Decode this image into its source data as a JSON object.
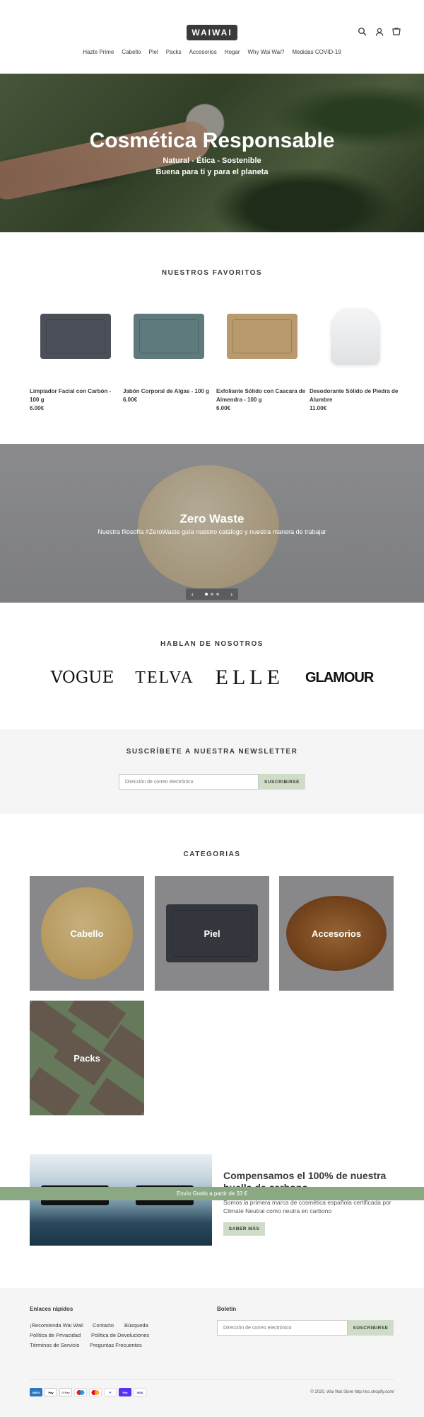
{
  "header": {
    "logo_text": "WAIWAI",
    "nav": [
      "Hazte Prime",
      "Cabello",
      "Piel",
      "Packs",
      "Accesorios",
      "Hogar",
      "Why Wai Wai?",
      "Medidas COVID-19"
    ],
    "icons": [
      "search-icon",
      "account-icon",
      "cart-icon"
    ]
  },
  "hero": {
    "title": "Cosmética Responsable",
    "subtitle1": "Natural - Ética - Sostenible",
    "subtitle2": "Buena para ti y para el planeta"
  },
  "favorites": {
    "title": "NUESTROS FAVORITOS",
    "products": [
      {
        "name": "Limpiador Facial con Carbón - 100 g",
        "price": "6.00€",
        "color": "#4b5058"
      },
      {
        "name": "Jabón Corporal de Algas - 100 g",
        "price": "6.00€",
        "color": "#5f7a7c"
      },
      {
        "name": "Exfoliante Sólido con Cascara de Almendra - 100 g",
        "price": "6.00€",
        "color": "#b89a6e"
      },
      {
        "name": "Desodorante Sólido de Piedra de Alumbre",
        "price": "11.00€",
        "color": "#e9eaec"
      }
    ]
  },
  "slideshow": {
    "title": "Zero Waste",
    "text": "Nuestra filosofía #ZeroWaste guía nuestro catálogo y nuestra manera de trabajar",
    "prev": "‹",
    "next": "›",
    "active_slide": 1,
    "slide_count": 3
  },
  "press": {
    "title": "HABLAN DE NOSOTROS",
    "logos": [
      "VOGUE",
      "TELVA",
      "ELLE",
      "GLAMOUR"
    ]
  },
  "newsletter": {
    "title": "SUSCRÍBETE A NUESTRA NEWSLETTER",
    "placeholder": "Dirección de correo electrónico",
    "button": "SUSCRIBIRSE"
  },
  "categories": {
    "title": "CATEGORIAS",
    "items": [
      "Cabello",
      "Piel",
      "Accesorios",
      "Packs"
    ]
  },
  "carbon": {
    "title": "Compensamos el 100% de nuestra huella de carbono",
    "text": "Somos la primera marca de cosmética española certificada por Climate Neutral como neutra en carbono",
    "button": "SABER MÁS",
    "image_logo": "WAIWAI"
  },
  "banner": {
    "text": "Envío Gratis a partir de 33 €"
  },
  "footer": {
    "links_title": "Enlaces rápidos",
    "links": [
      "¡Recomienda Wai Wai!",
      "Contacto",
      "Búsqueda",
      "Política de Privacidad",
      "Política de Devoluciones",
      "Términos de Servicio",
      "Preguntas Frecuentes"
    ],
    "newsletter_title": "Boletín",
    "placeholder": "Dirección de correo electrónico",
    "button": "SUSCRIBIRSE",
    "payments": [
      "AMEX",
      "Pay",
      "G Pay",
      "",
      "",
      "P",
      "Pay",
      "VISA"
    ],
    "copyright": "© 2020, Wai Wai Store http://es.shopify.com/"
  }
}
